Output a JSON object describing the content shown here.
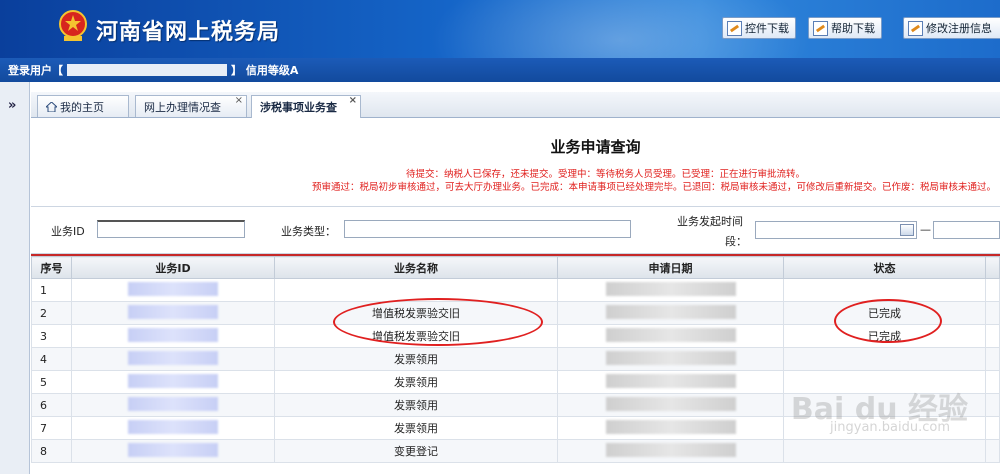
{
  "header": {
    "site_title": "河南省网上税务局",
    "buttons": [
      {
        "label": "控件下载"
      },
      {
        "label": "帮助下载"
      },
      {
        "label": "修改注册信息"
      }
    ]
  },
  "userbar": {
    "prefix": "登录用户【",
    "suffix": "】 信用等级A"
  },
  "leftstrip": {
    "expand_glyph": "»"
  },
  "tabs": [
    {
      "label": "我的主页"
    },
    {
      "label": "网上办理情况查"
    },
    {
      "label": "涉税事项业务查"
    }
  ],
  "tab_close": "×",
  "main": {
    "title": "业务申请查询",
    "note1": "待提交：纳税人已保存，还未提交。受理中：等待税务人员受理。已受理：正在进行审批流转。",
    "note2": "预审通过：税局初步审核通过，可去大厅办理业务。已完成：本申请事项已经处理完毕。已退回：税局审核未通过，可修改后重新提交。已作废：税局审核未通过。",
    "search": {
      "id_label": "业务ID",
      "type_label": "业务类型：",
      "time_label_1": "业务发起时间",
      "time_label_2": "段：",
      "range_sep": "—"
    },
    "table": {
      "headers": [
        "序号",
        "业务ID",
        "业务名称",
        "申请日期",
        "状态"
      ],
      "rows": [
        {
          "seq": "1",
          "name": "",
          "status": ""
        },
        {
          "seq": "2",
          "name": "增值税发票验交旧",
          "status": "已完成"
        },
        {
          "seq": "3",
          "name": "增值税发票验交旧",
          "status": "已完成"
        },
        {
          "seq": "4",
          "name": "发票领用",
          "status": ""
        },
        {
          "seq": "5",
          "name": "发票领用",
          "status": ""
        },
        {
          "seq": "6",
          "name": "发票领用",
          "status": ""
        },
        {
          "seq": "7",
          "name": "发票领用",
          "status": ""
        },
        {
          "seq": "8",
          "name": "变更登记",
          "status": ""
        }
      ]
    }
  },
  "watermark": {
    "brand": "Bai du 经验",
    "url": "jingyan.baidu.com"
  },
  "colors": {
    "header_blue": "#1565c8",
    "notice_red": "#e0201e",
    "annotation_red": "#e02020"
  }
}
